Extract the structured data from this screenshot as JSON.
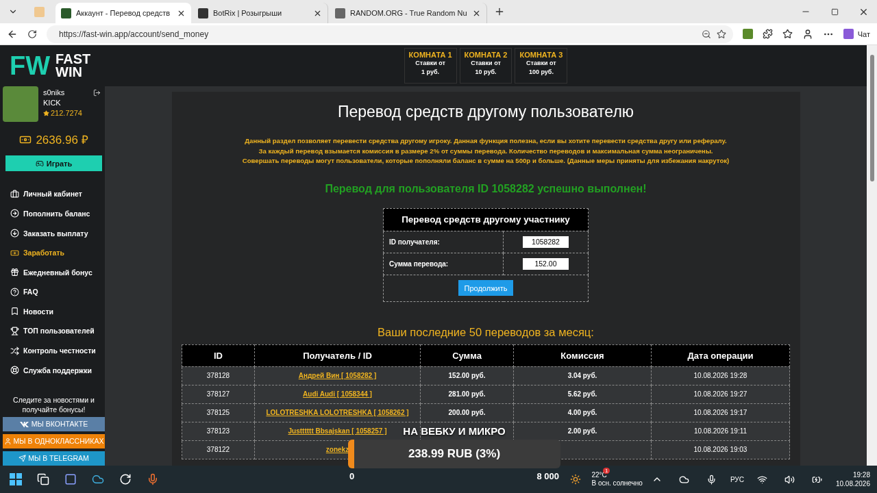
{
  "browser": {
    "tabs": [
      {
        "title": "Аккаунт - Перевод средств",
        "selected": true
      },
      {
        "title": "BotRix | Розыгрыши",
        "selected": false
      },
      {
        "title": "RANDOM.ORG - True Random Nu",
        "selected": false
      }
    ],
    "url": "https://fast-win.app/account/send_money",
    "chat": "Чат"
  },
  "header": {
    "logo": {
      "mark": "FW",
      "lines": [
        "FAST",
        "WIN"
      ]
    },
    "rooms": [
      {
        "title": "КОМНАТА 1",
        "line1": "Ставки от",
        "line2": "1 руб."
      },
      {
        "title": "КОМНАТА 2",
        "line1": "Ставки от",
        "line2": "10 руб."
      },
      {
        "title": "КОМНАТА 3",
        "line1": "Ставки от",
        "line2": "100 руб."
      }
    ]
  },
  "sidebar": {
    "user": {
      "name": "s0niks",
      "tag": "KICK",
      "rating": "212.7274"
    },
    "balance": "2636.96 ₽",
    "play": "Играть",
    "menu": [
      {
        "label": "Личный кабинет",
        "selected": false
      },
      {
        "label": "Пополнить баланс",
        "selected": false
      },
      {
        "label": "Заказать выплату",
        "selected": false
      },
      {
        "label": "Заработать",
        "selected": true
      },
      {
        "label": "Ежедневный бонус",
        "selected": false
      },
      {
        "label": "FAQ",
        "selected": false
      },
      {
        "label": "Новости",
        "selected": false
      },
      {
        "label": "ТОП пользователей",
        "selected": false
      },
      {
        "label": "Контроль честности",
        "selected": false
      },
      {
        "label": "Служба поддержки",
        "selected": false
      }
    ],
    "follow": "Следите за новостями и получайте бонусы!",
    "socials": [
      {
        "label": "МЫ ВКОНТАКТЕ",
        "kind": "vk"
      },
      {
        "label": "МЫ В ОДНОКЛАССНИКАХ",
        "kind": "ok"
      },
      {
        "label": "МЫ В TELEGRAM",
        "kind": "tg"
      }
    ]
  },
  "main": {
    "title": "Перевод средств другому пользователю",
    "info": [
      "Данный раздел позволяет перевести средства другому игроку. Данная функция полезна, если вы хотите перевести средства другу или рефералу.",
      "За каждый перевод взымается комиссия в размере 2% от суммы перевода. Количество переводов и максимальная сумма неограничены.",
      "Совершать переводы могут пользователи, которые пополняли баланс в сумме на 500р и больше. (Данные меры приняты для избежания накруток)"
    ],
    "success": "Перевод для пользователя ID 1058282 успешно выполнен!",
    "form": {
      "title": "Перевод средств другому участнику",
      "fields": [
        {
          "label": "ID получателя:",
          "value": "1058282"
        },
        {
          "label": "Сумма перевода:",
          "value": "152.00"
        }
      ],
      "button": "Продолжить"
    },
    "history_title": "Ваши последние 50 переводов за месяц:",
    "table": {
      "columns": [
        "ID",
        "Получатель / ID",
        "Сумма",
        "Комиссия",
        "Дата операции"
      ],
      "rows": [
        {
          "id": "378128",
          "recipient": "Андрей Вин [ 1058282 ]",
          "sum": "152.00 руб.",
          "fee": "3.04 руб.",
          "date": "10.08.2026 19:28"
        },
        {
          "id": "378127",
          "recipient": "Audi Audi [ 1058344 ]",
          "sum": "281.00 руб.",
          "fee": "5.62 руб.",
          "date": "10.08.2026 19:27"
        },
        {
          "id": "378125",
          "recipient": "LOLOTRESHKA LOLOTRESHKA [ 1058262 ]",
          "sum": "200.00 руб.",
          "fee": "4.00 руб.",
          "date": "10.08.2026 19:17"
        },
        {
          "id": "378123",
          "recipient": "Justttttt Bbsajskan [ 1058257 ]",
          "fee": "2.00 руб.",
          "date": "10.08.2026 19:11"
        },
        {
          "id": "378122",
          "recipient": "zonekz",
          "date": "10.08.2026 19:03"
        }
      ]
    }
  },
  "overlay": {
    "title": "НА ВЕБКУ И МИКРО",
    "amount": "238.99 RUB (3%)",
    "level": 0.03,
    "min": "0",
    "max": "8 000"
  },
  "taskbar": {
    "badge": "1",
    "temp": "22°C",
    "weather": "В осн. солнечно",
    "lang": "РУС",
    "time": "19:28",
    "date": "10.08.2026"
  }
}
